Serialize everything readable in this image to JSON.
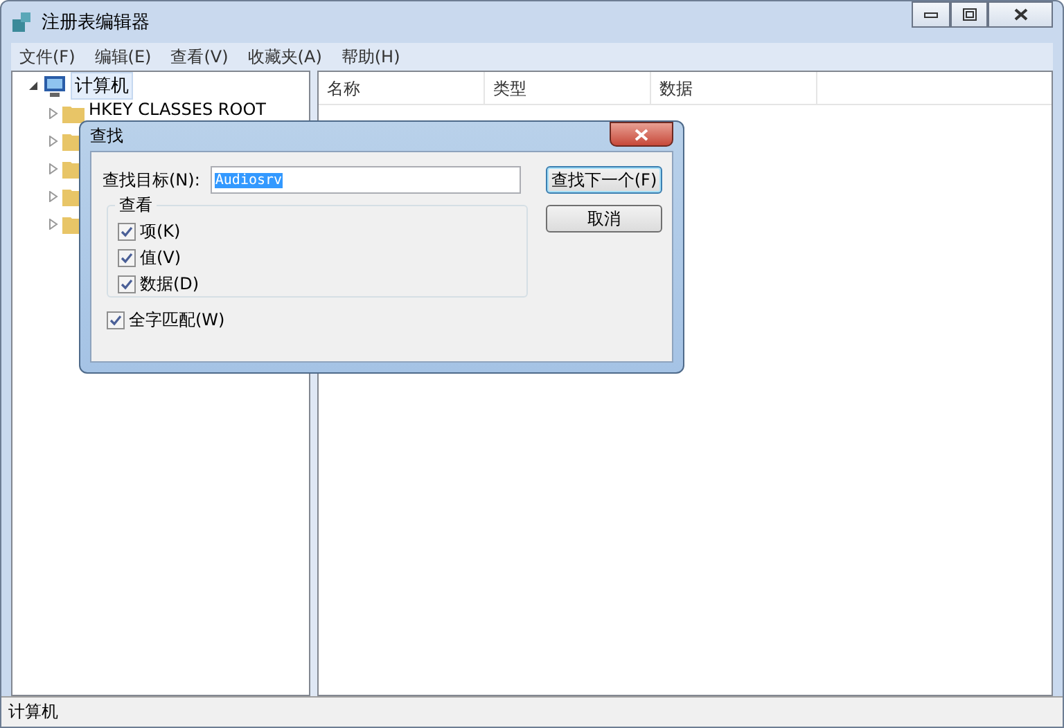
{
  "window": {
    "title": "注册表编辑器"
  },
  "menu": [
    "文件(F)",
    "编辑(E)",
    "查看(V)",
    "收藏夹(A)",
    "帮助(H)"
  ],
  "tree": {
    "label": "计算机",
    "expanded": true,
    "selected": true,
    "children": [
      {
        "label": "HKEY CLASSES ROOT",
        "expanded": false
      },
      {
        "expanded": false
      },
      {
        "expanded": false
      },
      {
        "expanded": false
      },
      {
        "expanded": false
      }
    ]
  },
  "list": {
    "columns": [
      "名称",
      "类型",
      "数据"
    ]
  },
  "status_bar": "计算机",
  "dialog": {
    "title": "查找",
    "find_label": "查找目标(N):",
    "find_value": "Audiosrv",
    "group_title": "查看",
    "options": [
      {
        "label": "项(K)",
        "checked": true
      },
      {
        "label": "值(V)",
        "checked": true
      },
      {
        "label": "数据(D)",
        "checked": true
      }
    ],
    "whole_match": {
      "label": "全字匹配(W)",
      "checked": true
    },
    "buttons": [
      "查找下一个(F)",
      "取消"
    ]
  }
}
